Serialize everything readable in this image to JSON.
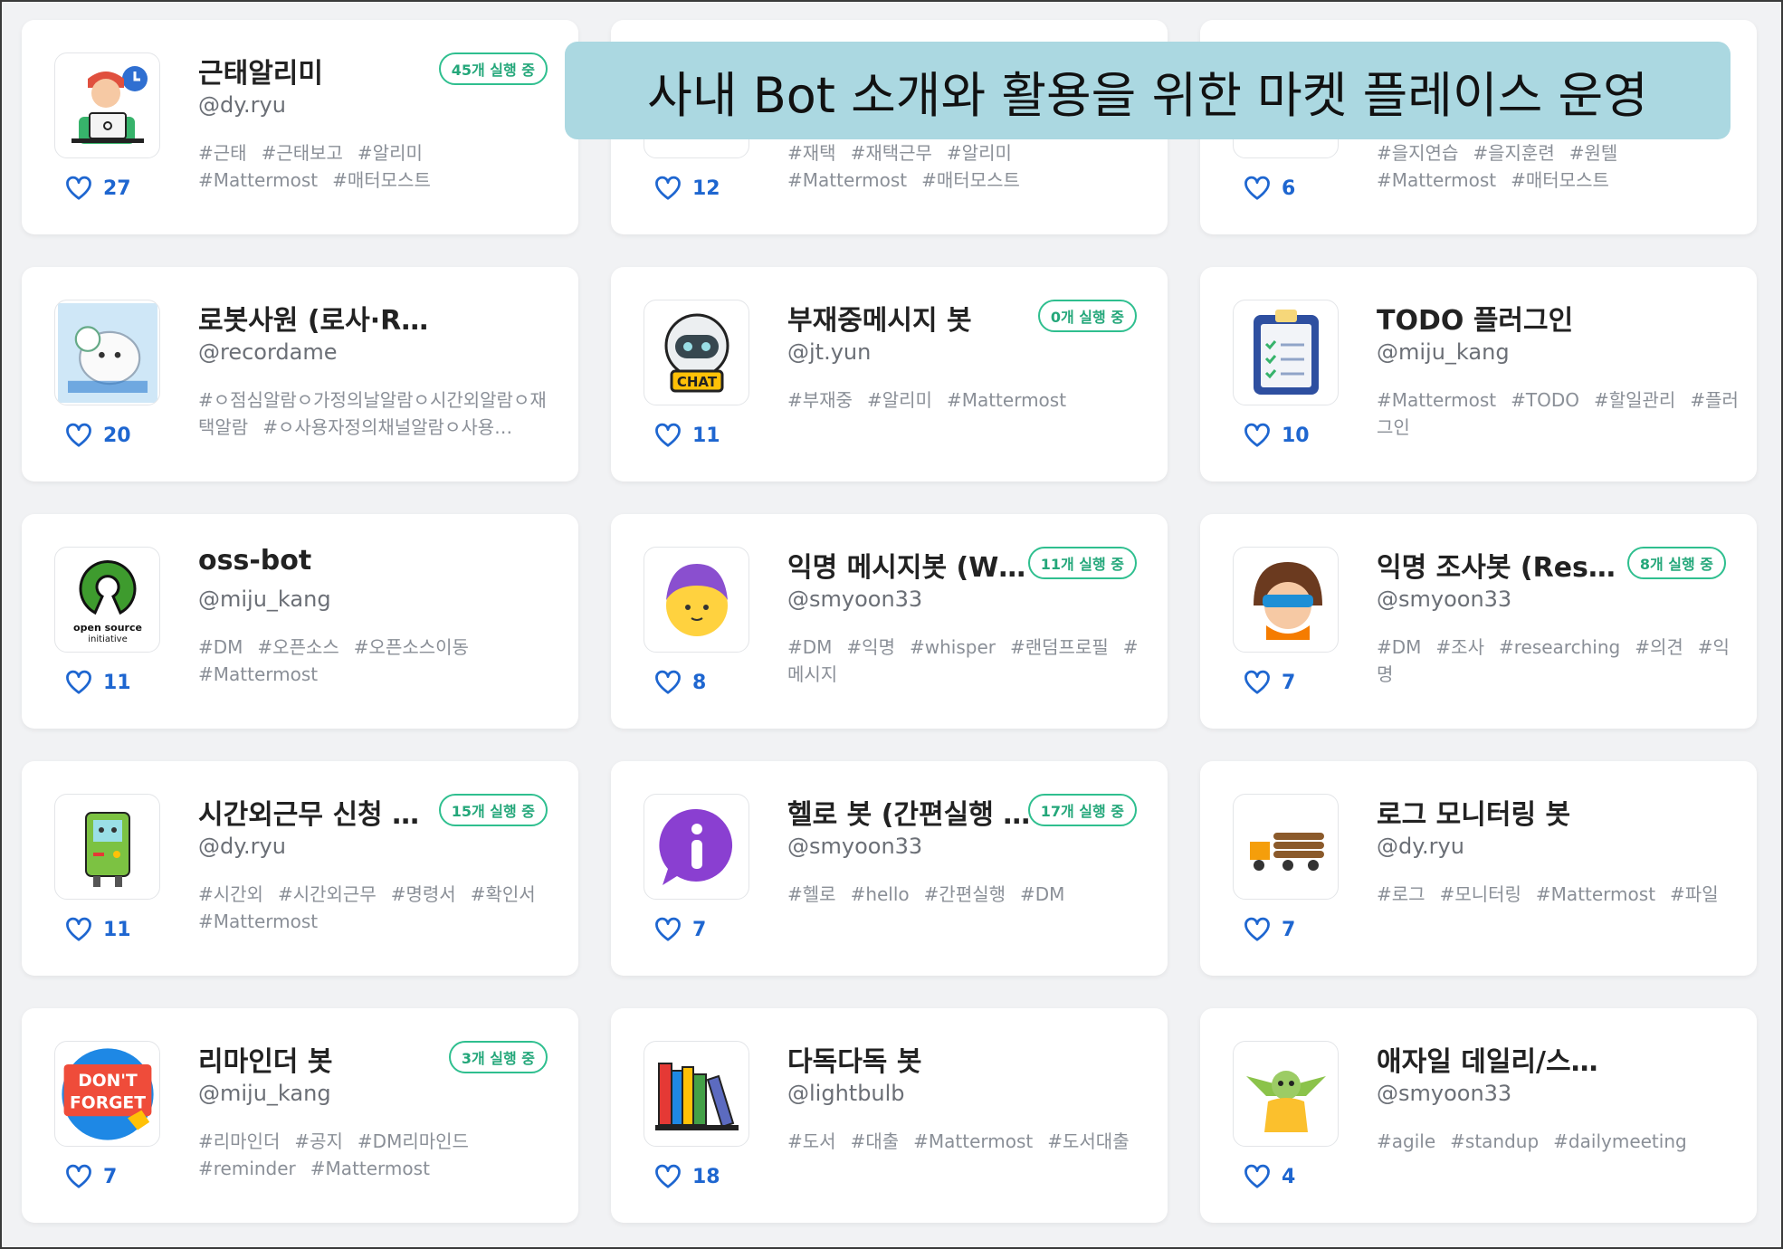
{
  "banner": {
    "text": "사내 Bot 소개와 활용을 위한 마켓 플레이스 운영"
  },
  "colors": {
    "like": "#1e66d0",
    "badge": "#24a77a",
    "banner_bg": "#abd8e1"
  },
  "bots": [
    {
      "title": "근태알리미",
      "author": "@dy.ryu",
      "likes": "27",
      "badge": "45개 실행 중",
      "icon": "developer-avatar-icon",
      "tags": [
        "#근태",
        "#근태보고",
        "#알리미",
        "#Mattermost",
        "#매터모스트"
      ]
    },
    {
      "title": "",
      "author": "",
      "likes": "12",
      "badge": "",
      "icon": "partial-thumbnail-icon",
      "tags": [
        "#재택",
        "#재택근무",
        "#알리미",
        "#Mattermost",
        "#매터모스트"
      ]
    },
    {
      "title": "",
      "author": "",
      "likes": "6",
      "badge": "",
      "icon": "partial-thumbnail-icon",
      "tags": [
        "#을지연습",
        "#을지훈련",
        "#원텔",
        "#Mattermost",
        "#매터모스트"
      ]
    },
    {
      "title": "로봇사원 (로사·ROSA)",
      "author": "@recordame",
      "likes": "20",
      "badge": "",
      "icon": "robot-pilot-icon",
      "tags": [
        "#ㅇ점심알람ㅇ가정의날알람ㅇ시간외알람ㅇ재택알람",
        "#ㅇ사용자정의채널알람ㅇ사용…"
      ]
    },
    {
      "title": "부재중메시지 봇",
      "author": "@jt.yun",
      "likes": "11",
      "badge": "0개 실행 중",
      "icon": "chat-robot-icon",
      "tags": [
        "#부재중",
        "#알리미",
        "#Mattermost"
      ]
    },
    {
      "title": "TODO 플러그인",
      "author": "@miju_kang",
      "likes": "10",
      "badge": "",
      "icon": "clipboard-checklist-icon",
      "tags": [
        "#Mattermost",
        "#TODO",
        "#할일관리",
        "#플러그인"
      ]
    },
    {
      "title": "oss-bot",
      "author": "@miju_kang",
      "likes": "11",
      "badge": "",
      "icon": "open-source-logo-icon",
      "tags": [
        "#DM",
        "#오픈소스",
        "#오픈소스이동",
        "#Mattermost"
      ]
    },
    {
      "title": "익명 메시지봇 (Wh…",
      "author": "@smyoon33",
      "likes": "8",
      "badge": "11개 실행 중",
      "icon": "purple-hair-face-icon",
      "tags": [
        "#DM",
        "#익명",
        "#whisper",
        "#랜덤프로필",
        "#메시지"
      ]
    },
    {
      "title": "익명 조사봇 (Resea…",
      "author": "@smyoon33",
      "likes": "7",
      "badge": "8개 실행 중",
      "icon": "goggles-face-icon",
      "tags": [
        "#DM",
        "#조사",
        "#researching",
        "#의견",
        "#익명"
      ]
    },
    {
      "title": "시간외근무 신청 알…",
      "author": "@dy.ryu",
      "likes": "11",
      "badge": "15개 실행 중",
      "icon": "game-robot-icon",
      "tags": [
        "#시간외",
        "#시간외근무",
        "#명령서",
        "#확인서",
        "#Mattermost"
      ]
    },
    {
      "title": "헬로 봇 (간편실행 …",
      "author": "@smyoon33",
      "likes": "7",
      "badge": "17개 실행 중",
      "icon": "info-bubble-icon",
      "tags": [
        "#헬로",
        "#hello",
        "#간편실행",
        "#DM"
      ]
    },
    {
      "title": "로그 모니터링 봇",
      "author": "@dy.ryu",
      "likes": "7",
      "badge": "",
      "icon": "log-truck-icon",
      "tags": [
        "#로그",
        "#모니터링",
        "#Mattermost",
        "#파일"
      ]
    },
    {
      "title": "리마인더 봇",
      "author": "@miju_kang",
      "likes": "7",
      "badge": "3개 실행 중",
      "icon": "dont-forget-icon",
      "icon_text": [
        "DON'T",
        "FORGET"
      ],
      "tags": [
        "#리마인더",
        "#공지",
        "#DM리마인드",
        "#reminder",
        "#Mattermost"
      ]
    },
    {
      "title": "다독다독 봇",
      "author": "@lightbulb",
      "likes": "18",
      "badge": "",
      "icon": "books-icon",
      "tags": [
        "#도서",
        "#대출",
        "#Mattermost",
        "#도서대출"
      ]
    },
    {
      "title": "애자일 데일리/스탠드업 미팅…",
      "author": "@smyoon33",
      "likes": "4",
      "badge": "",
      "icon": "yoda-icon",
      "tags": [
        "#agile",
        "#standup",
        "#dailymeeting"
      ]
    }
  ]
}
